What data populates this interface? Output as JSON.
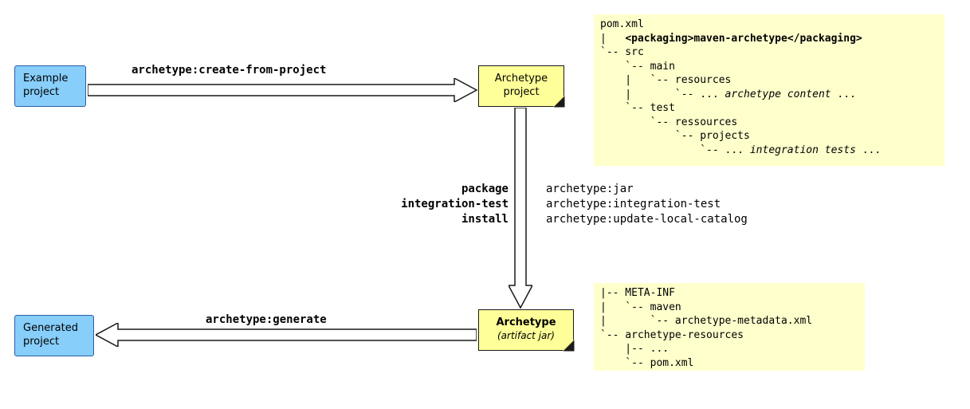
{
  "boxes": {
    "example_project": "Example\nproject",
    "generated_project": "Generated\nproject",
    "archetype_project": "Archetype\nproject",
    "archetype_artifact_title": "Archetype",
    "archetype_artifact_sub": "(artifact jar)"
  },
  "labels": {
    "create": "archetype:create-from-project",
    "package_l1": "package",
    "package_l2": "integration-test",
    "package_l3": "install",
    "goals_l1": "archetype:jar",
    "goals_l2": "archetype:integration-test",
    "goals_l3": "archetype:update-local-catalog",
    "generate": "archetype:generate"
  },
  "panel_top": {
    "l1": "pom.xml",
    "l2a": "|   ",
    "l2b": "<packaging>",
    "l2c": "maven-archetype",
    "l2d": "</packaging>",
    "l3": "`-- src",
    "l4": "    `-- main",
    "l5": "    |   `-- resources",
    "l6a": "    |       `-- ... ",
    "l6b": "archetype content",
    "l6c": " ...",
    "l7": "    `-- test",
    "l8": "        `-- ressources",
    "l9": "            `-- projects",
    "l10a": "                `-- ... ",
    "l10b": "integration tests",
    "l10c": " ..."
  },
  "panel_bottom": {
    "l1": "|-- META-INF",
    "l2": "|   `-- maven",
    "l3": "|       `-- archetype-metadata.xml",
    "l4": "`-- archetype-resources",
    "l5": "    |-- ...",
    "l6": "    `-- pom.xml"
  }
}
